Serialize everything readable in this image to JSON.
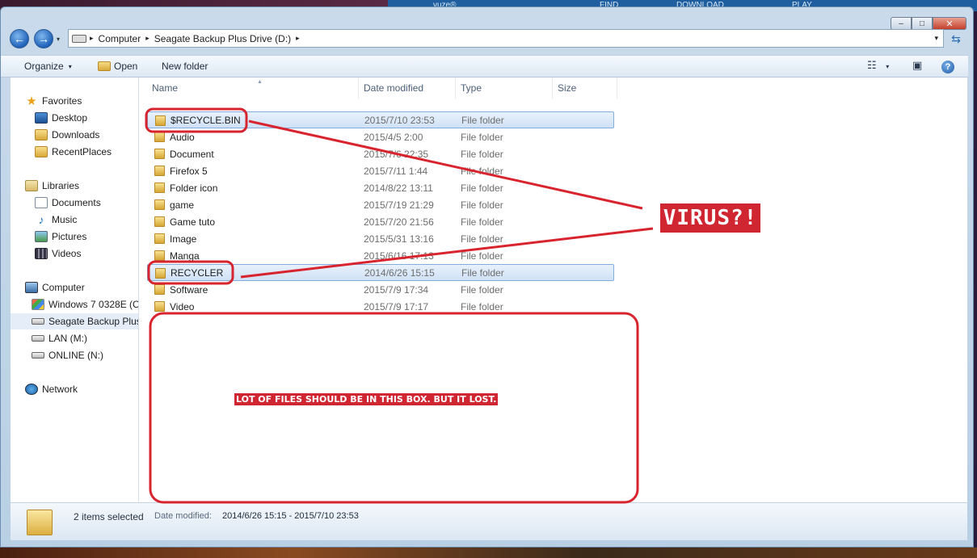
{
  "background_app": {
    "brand": "vuze®",
    "tabs": [
      "FIND",
      "DOWNLOAD",
      "PLAY"
    ]
  },
  "window": {
    "caption_buttons": {
      "minimize": "–",
      "maximize": "□",
      "close": "✕"
    }
  },
  "navigation": {
    "back_icon": "←",
    "forward_icon": "→",
    "recent_caret": "▾",
    "breadcrumb": [
      "Computer",
      "Seagate Backup Plus Drive (D:)"
    ],
    "separator": "▸",
    "address_caret": "▾",
    "refresh_icon": "⇆"
  },
  "toolbar": {
    "organize": "Organize",
    "open": "Open",
    "new_folder": "New folder",
    "caret": "▾",
    "views_icon": "☷",
    "preview_icon": "▣",
    "help_icon": "?"
  },
  "nav_pane": {
    "items": [
      {
        "label": "Favorites",
        "icon": "star-icon"
      },
      {
        "label": "Desktop",
        "icon": "desktop-icon"
      },
      {
        "label": "Downloads",
        "icon": "folder-icon"
      },
      {
        "label": "RecentPlaces",
        "icon": "folder-icon"
      },
      {
        "label": "Libraries",
        "icon": "library-icon"
      },
      {
        "label": "Documents",
        "icon": "documents-icon"
      },
      {
        "label": "Music",
        "icon": "music-icon"
      },
      {
        "label": "Pictures",
        "icon": "pictures-icon"
      },
      {
        "label": "Videos",
        "icon": "videos-icon"
      },
      {
        "label": "Computer",
        "icon": "computer-icon"
      },
      {
        "label": "Windows 7 0328E (C",
        "icon": "windows-drive-icon"
      },
      {
        "label": "Seagate Backup Plus",
        "icon": "drive-icon",
        "selected": true
      },
      {
        "label": "LAN (M:)",
        "icon": "network-drive-icon"
      },
      {
        "label": "ONLINE (N:)",
        "icon": "network-drive-icon"
      },
      {
        "label": "Network",
        "icon": "network-icon"
      }
    ]
  },
  "columns": {
    "name": "Name",
    "date": "Date modified",
    "type": "Type",
    "size": "Size"
  },
  "files": [
    {
      "name": "$RECYCLE.BIN",
      "date": "2015/7/10 23:53",
      "type": "File folder",
      "selected": true
    },
    {
      "name": "Audio",
      "date": "2015/4/5 2:00",
      "type": "File folder"
    },
    {
      "name": "Document",
      "date": "2015/7/6 22:35",
      "type": "File folder"
    },
    {
      "name": "Firefox 5",
      "date": "2015/7/11 1:44",
      "type": "File folder"
    },
    {
      "name": "Folder icon",
      "date": "2014/8/22 13:11",
      "type": "File folder"
    },
    {
      "name": "game",
      "date": "2015/7/19 21:29",
      "type": "File folder"
    },
    {
      "name": "Game tuto",
      "date": "2015/7/20 21:56",
      "type": "File folder"
    },
    {
      "name": "Image",
      "date": "2015/5/31 13:16",
      "type": "File folder"
    },
    {
      "name": "Manga",
      "date": "2015/6/16 17:13",
      "type": "File folder"
    },
    {
      "name": "RECYCLER",
      "date": "2014/6/26 15:15",
      "type": "File folder",
      "selected": true
    },
    {
      "name": "Software",
      "date": "2015/7/9 17:34",
      "type": "File folder"
    },
    {
      "name": "Video",
      "date": "2015/7/9 17:17",
      "type": "File folder"
    }
  ],
  "status": {
    "count": "2 items selected",
    "date_label": "Date modified:",
    "date_value": "2014/6/26 15:15 - 2015/7/10 23:53"
  },
  "annotations": {
    "virus": "VIRUS?!",
    "lost": "LOT OF FILES SHOULD BE IN THIS BOX. BUT IT LOST.",
    "color": "#d8242e"
  }
}
